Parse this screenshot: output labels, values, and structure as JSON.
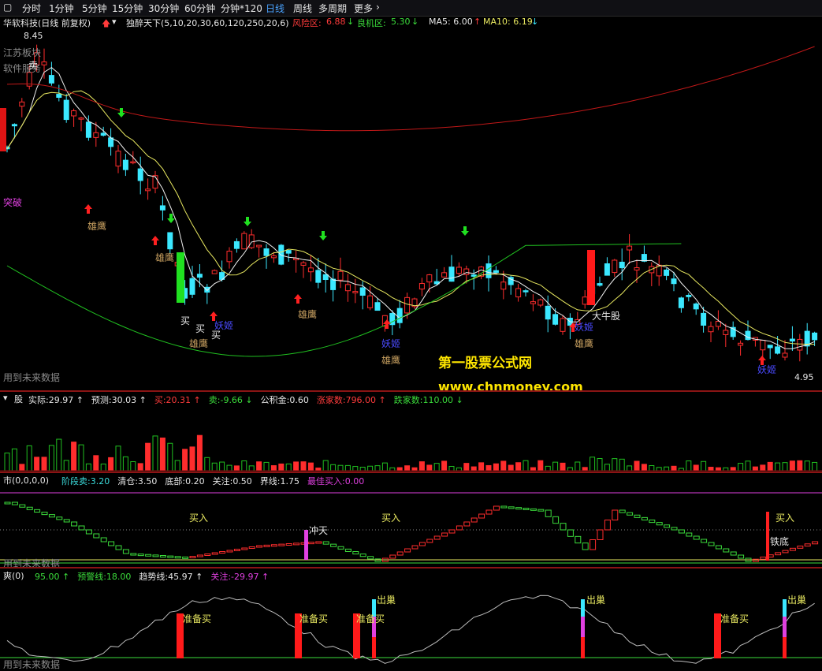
{
  "toolbar": {
    "items": [
      "分时",
      "1分钟",
      "5分钟",
      "15分钟",
      "30分钟",
      "60分钟",
      "分钟*120",
      "日线",
      "周线",
      "多周期",
      "更多"
    ],
    "active": "日线"
  },
  "main": {
    "stock": "华软科技(日线 前复权)",
    "indicator": "独醉天下(5,10,20,30,60,120,250,20,6)",
    "risk_label": "风险区:",
    "risk_value": "6.88",
    "good_label": "良机区:",
    "good_value": "5.30",
    "ma5": "MA5: 6.00",
    "ma10": "MA10: 6.19",
    "high_price": "8.45",
    "low_price": "4.95",
    "side_tags": [
      "江苏板块",
      "软件服务"
    ],
    "future_data": "用到未来数据",
    "signals": {
      "xiongying": "雄鹰",
      "tupo": "突破",
      "mai": "卖",
      "buy": "买",
      "yaoji": "妖姬",
      "daniu": "大牛股"
    }
  },
  "watermark": {
    "line1": "第一股票公式网",
    "line2": "www.chnmoney.com"
  },
  "panel_volume": {
    "title": "股",
    "items": [
      {
        "label": "实际:",
        "value": "29.97",
        "arrow": "↑",
        "color": "#e6e6e6"
      },
      {
        "label": "预测:",
        "value": "30.03",
        "arrow": "↑",
        "color": "#e6e6e6"
      },
      {
        "label": "买:",
        "value": "20.31",
        "arrow": "↑",
        "color": "#ff3b3b"
      },
      {
        "label": "卖:",
        "value": "-9.66",
        "arrow": "↓",
        "color": "#3bdc3b"
      },
      {
        "label": "公积金:",
        "value": "0.60",
        "arrow": "",
        "color": "#e6e6e6"
      },
      {
        "label": "涨家数:",
        "value": "796.00",
        "arrow": "↑",
        "color": "#ff3b3b"
      },
      {
        "label": "跌家数:",
        "value": "110.00",
        "arrow": "↓",
        "color": "#3bdc3b"
      }
    ]
  },
  "panel_market": {
    "title": "市(0,0,0,0)",
    "items": [
      {
        "label": "阶段卖:",
        "value": "3.20",
        "color": "#3bdcdc"
      },
      {
        "label": "清仓:",
        "value": "3.50",
        "color": "#e6e6e6"
      },
      {
        "label": "底部:",
        "value": "0.20",
        "color": "#e6e6e6"
      },
      {
        "label": "关注:",
        "value": "0.50",
        "color": "#e6e6e6"
      },
      {
        "label": "界线:",
        "value": "1.75",
        "color": "#e6e6e6"
      },
      {
        "label": "最佳买入:",
        "value": "0.00",
        "color": "#e040e0"
      }
    ],
    "labels": {
      "buy": "买入",
      "chongtian": "冲天",
      "tiedi": "铁底"
    },
    "future_data": "用到未来数据"
  },
  "panel_shuang": {
    "title": "爽(0)",
    "items": [
      {
        "label": "",
        "value": "95.00",
        "arrow": "↑",
        "color": "#3bdc3b"
      },
      {
        "label": "预警线:",
        "value": "18.00",
        "arrow": "",
        "color": "#3bdc3b"
      },
      {
        "label": "趋势线:",
        "value": "45.97",
        "arrow": "↑",
        "color": "#e6e6e6"
      },
      {
        "label": "关注:",
        "value": "-29.97",
        "arrow": "↑",
        "color": "#e040e0"
      }
    ],
    "labels": {
      "ready": "准备买",
      "chuchao": "出巢"
    },
    "future_data": "用到未来数据"
  },
  "colors": {
    "up": "#ff2d2d",
    "down": "#3be8ff",
    "ma_yellow": "#e8e860",
    "ma_white": "#f0f0f0",
    "ma_red": "#c01818",
    "ma_green": "#20c020"
  }
}
